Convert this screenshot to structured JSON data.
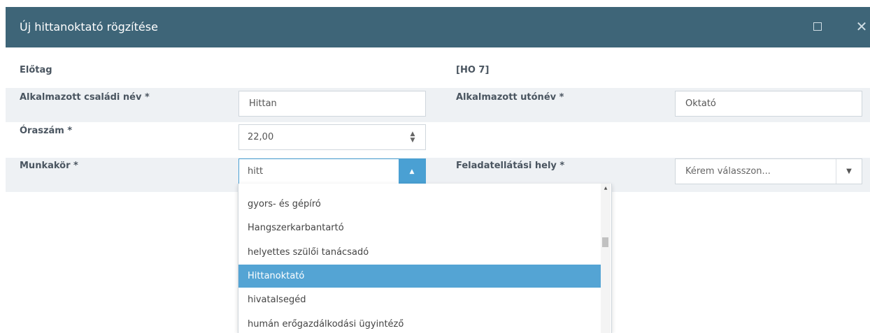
{
  "dialog": {
    "title": "Új hittanoktató rögzítése",
    "maximize_icon": "maximize-icon",
    "close_icon": "close-icon",
    "close_glyph": "✕"
  },
  "form": {
    "prefix_label": "Előtag",
    "prefix_value": "[HO 7]",
    "family_name_label": "Alkalmazott családi név *",
    "family_name_value": "Hittan",
    "given_name_label": "Alkalmazott utónév *",
    "given_name_value": "Oktató",
    "hours_label": "Óraszám *",
    "hours_value": "22,00",
    "job_label": "Munkakör *",
    "job_value": "hitt",
    "place_label": "Feladatellátási hely *",
    "place_placeholder": "Kérem válasszon..."
  },
  "dropdown": {
    "options": [
      "gyors- és gépíró",
      "Hangszerkarbantartó",
      "helyettes szülői tanácsadó",
      "Hittanoktató",
      "hivatalsegéd",
      "humán erőgazdálkodási ügyintéző"
    ],
    "selected": "Hittanoktató"
  },
  "colors": {
    "title_bar": "#3e6578",
    "accent": "#4aa0d3",
    "selected_row": "#54a4d4",
    "shaded_row": "#eef1f4"
  }
}
